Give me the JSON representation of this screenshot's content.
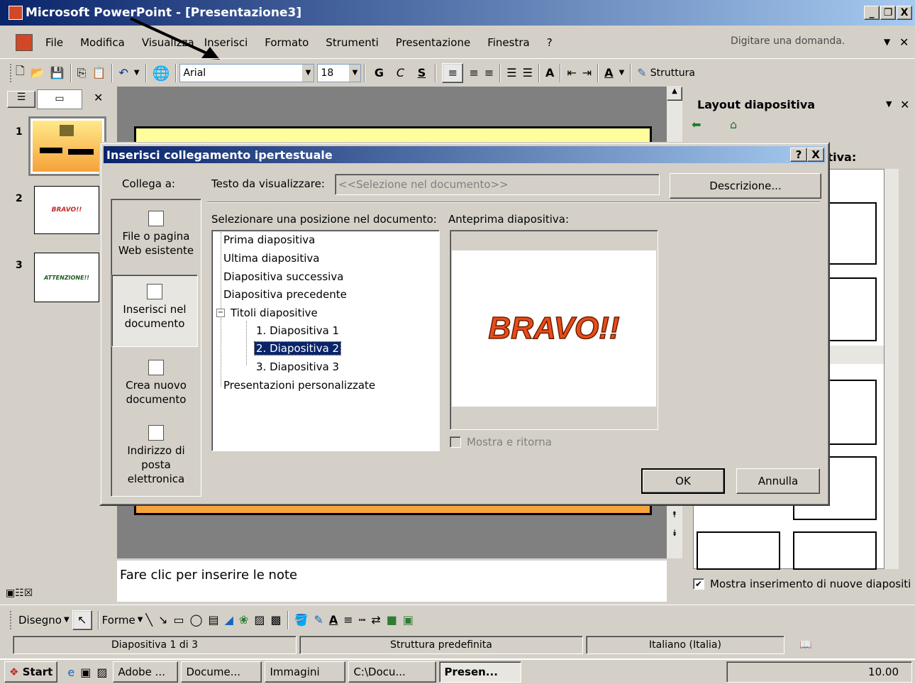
{
  "window": {
    "title": "Microsoft PowerPoint - [Presentazione3]",
    "min": "_",
    "max": "b",
    "close": "X"
  },
  "menu": {
    "items": [
      "File",
      "Modifica",
      "Visualizza",
      "Inserisci",
      "Formato",
      "Strumenti",
      "Presentazione",
      "Finestra",
      "?"
    ],
    "ask_placeholder": "Digitare una domanda.",
    "close": "✕"
  },
  "toolbar": {
    "font": "Arial",
    "size": "18",
    "bold": "G",
    "italic": "C",
    "shadow": "S",
    "bigger": "A",
    "struttura": "Struttura"
  },
  "leftpane": {
    "tab_close": "✕",
    "slides": [
      {
        "num": "1"
      },
      {
        "num": "2",
        "text": "BRAVO!!"
      },
      {
        "num": "3",
        "text": "ATTENZIONE!!"
      }
    ]
  },
  "taskpane": {
    "title": "Layout diapositiva",
    "close": "✕",
    "partial": "itiva:",
    "checkbox": "Mostra inserimento di nuove diapositi"
  },
  "notes": {
    "placeholder": "Fare clic per inserire le note"
  },
  "drawbar": {
    "disegno": "Disegno",
    "forme": "Forme"
  },
  "status": {
    "slide": "Diapositiva 1 di 3",
    "design": "Struttura predefinita",
    "lang": "Italiano (Italia)"
  },
  "taskbar": {
    "start": "Start",
    "tasks": [
      "Adobe ...",
      "Docume...",
      "Immagini",
      "C:\\Docu...",
      "Presen..."
    ],
    "clock": "10.00"
  },
  "dialog": {
    "title": "Inserisci collegamento ipertestuale",
    "help": "?",
    "close": "X",
    "link_to": "Collega a:",
    "text_label": "Testo da visualizzare:",
    "text_value": "<<Selezione nel documento>>",
    "desc_button": "Descrizione...",
    "select_label": "Selezionare una posizione nel documento:",
    "preview_label": "Anteprima diapositiva:",
    "preview_text": "BRAVO!!",
    "places": [
      {
        "l1": "File o pagina",
        "l2": "Web esistente"
      },
      {
        "l1": "Inserisci nel",
        "l2": "documento"
      },
      {
        "l1": "Crea nuovo",
        "l2": "documento"
      },
      {
        "l1": "Indirizzo di",
        "l2": "posta",
        "l3": "elettronica"
      }
    ],
    "tree": [
      "Prima diapositiva",
      "Ultima diapositiva",
      "Diapositiva successiva",
      "Diapositiva precedente",
      "Titoli diapositive",
      "1. Diapositiva 1",
      "2. Diapositiva 2",
      "3. Diapositiva 3",
      "Presentazioni personalizzate"
    ],
    "expand_sign": "−",
    "show_return": "Mostra e ritorna",
    "ok": "OK",
    "cancel": "Annulla"
  }
}
